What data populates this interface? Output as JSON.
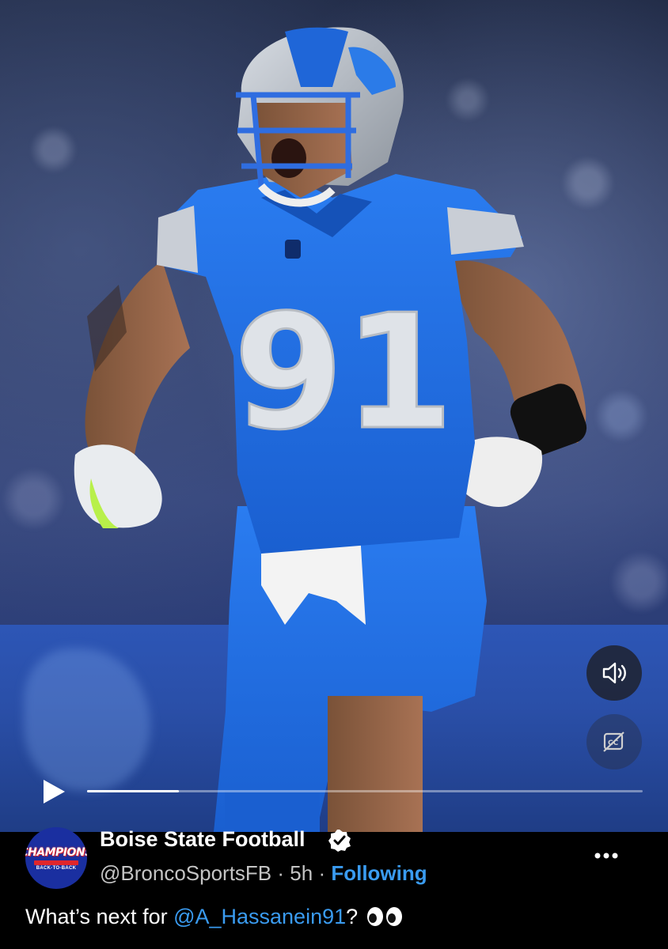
{
  "video": {
    "progress": 0.165,
    "sound_icon": "speaker-icon",
    "cc_icon": "closed-captions-off-icon",
    "play_icon": "play-icon",
    "jersey_number": "91"
  },
  "post": {
    "author_name": "Boise State Football",
    "avatar_text": "CHAMPIONS",
    "avatar_subtext": "BACK-TO-BACK",
    "handle": "@BroncoSportsFB",
    "separator": "·",
    "time": "5h",
    "follow_status": "Following",
    "text_prefix": "What’s next for ",
    "mention": "@A_Hassanein91",
    "text_suffix": "? ",
    "emoji": "eyes-emoji"
  },
  "colors": {
    "link": "#3a9bf0",
    "jersey_blue": "#1f6fe0",
    "verified_bg": "#ffffff"
  }
}
